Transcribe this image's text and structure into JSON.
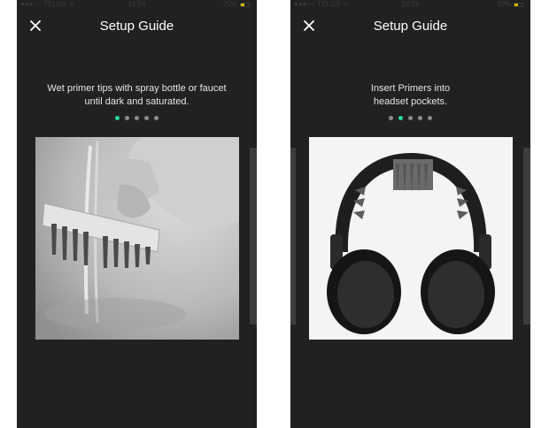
{
  "screens": [
    {
      "status": {
        "carrier": "●●●○○ TELUS ᯤ",
        "time": "18:54",
        "battery": "20%"
      },
      "title": "Setup Guide",
      "instruction": "Wet primer tips with spray bottle or faucet\nuntil dark and saturated.",
      "step": 1,
      "total_steps": 5,
      "image_icon": "primer-tips-photo"
    },
    {
      "status": {
        "carrier": "●●●○○ TELUS ᯤ",
        "time": "18:55",
        "battery": "20%"
      },
      "title": "Setup Guide",
      "instruction": "Insert Primers into\nheadset pockets.",
      "step": 2,
      "total_steps": 5,
      "image_icon": "headset-photo"
    }
  ],
  "colors": {
    "background": "#202120",
    "active_dot": "#29d7a6",
    "inactive_dot": "#8a8b8a"
  }
}
